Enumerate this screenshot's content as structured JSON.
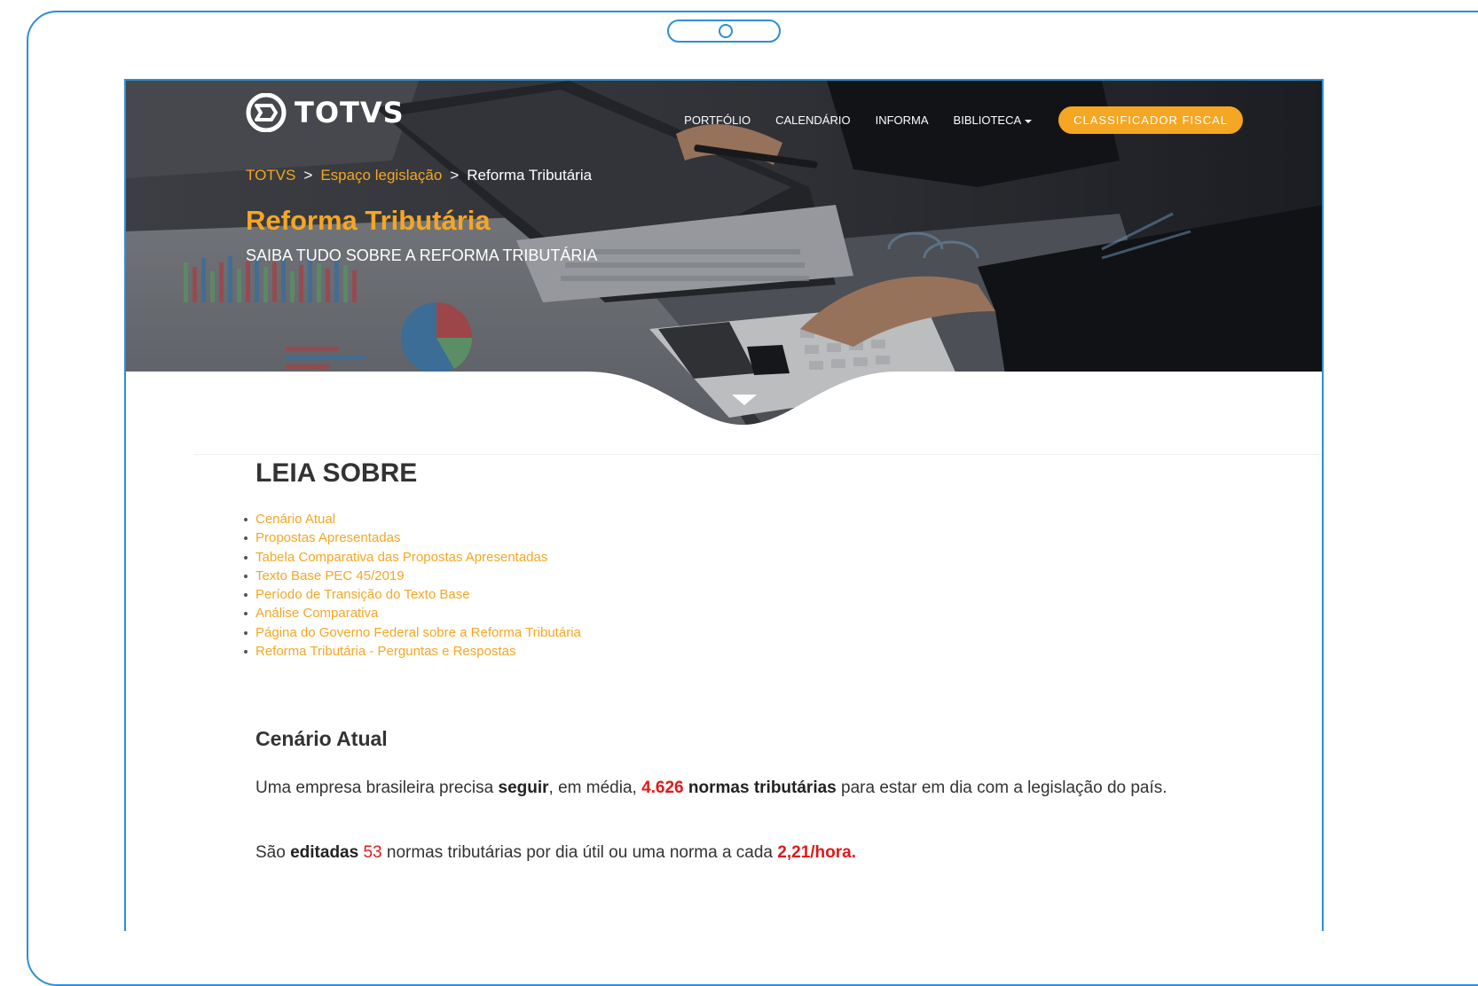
{
  "brand": {
    "name": "TOTVS"
  },
  "nav": {
    "items": [
      "PORTFÓLIO",
      "CALENDÁRIO",
      "INFORMA",
      "BIBLIOTECA"
    ],
    "cta": "CLASSIFICADOR FISCAL"
  },
  "breadcrumb": {
    "items": [
      "TOTVS",
      "Espaço legislação"
    ],
    "current": "Reforma Tributária",
    "separator": ">"
  },
  "hero": {
    "title": "Reforma Tributária",
    "subtitle": "SAIBA TUDO SOBRE A REFORMA TRIBUTÁRIA"
  },
  "leia_sobre": {
    "heading": "LEIA SOBRE",
    "links": [
      "Cenário Atual",
      "Propostas Apresentadas",
      "Tabela Comparativa das Propostas Apresentadas",
      "Texto Base PEC 45/2019",
      "Período de Transição do Texto Base",
      "Análise Comparativa",
      "Página do Governo Federal sobre a Reforma Tributária",
      "Reforma Tributária - Perguntas e Respostas"
    ]
  },
  "cenario": {
    "heading": "Cenário Atual",
    "p1": {
      "t1": "Uma empresa brasileira precisa ",
      "b1": "seguir",
      "t2": ", em média, ",
      "num": "4.626",
      "b2": " normas tributárias",
      "t3": " para estar em dia com a legislação do país."
    },
    "p2": {
      "t1": "São ",
      "b1": "editadas",
      "num": " 53",
      "t2": " normas tributárias por dia útil ou uma norma a cada ",
      "num2": "2,21/hora."
    }
  },
  "colors": {
    "accent": "#f5a623",
    "highlight": "#e0191a",
    "frame": "#2b8fd6",
    "text": "#333333"
  },
  "icons": [
    "totvs-logo-icon",
    "caret-down-icon",
    "scroll-down-arrow-icon",
    "camera-icon"
  ]
}
